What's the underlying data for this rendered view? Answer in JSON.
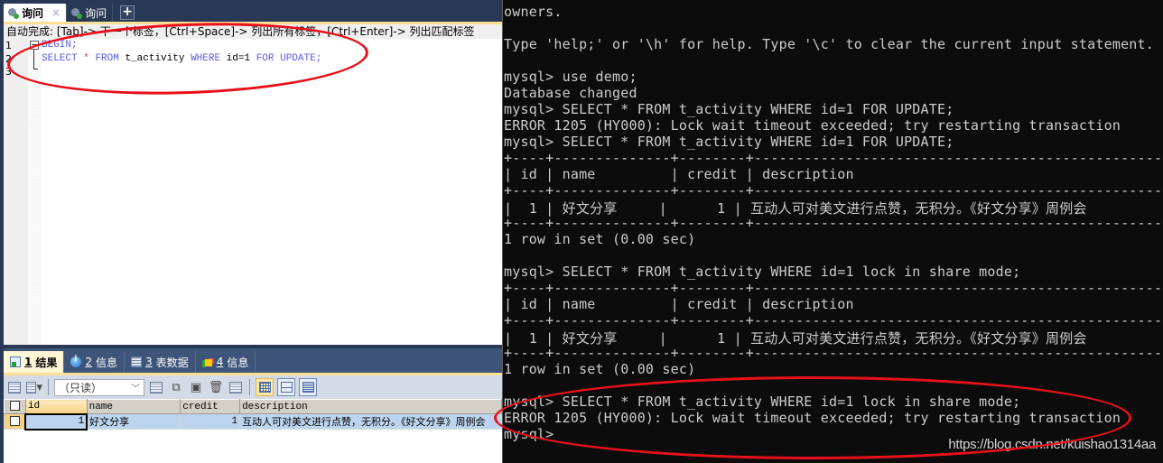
{
  "sql_client": {
    "query_tabs": [
      {
        "label": "询问",
        "active": true,
        "closable": true,
        "close_glyph": "×"
      },
      {
        "label": "询问",
        "active": false,
        "closable": false
      }
    ],
    "new_tab_glyph": "+",
    "autocomplete_hint": "自动完成: [Tab]-> 下一个标签，[Ctrl+Space]-> 列出所有标签，[Ctrl+Enter]-> 列出匹配标签",
    "editor": {
      "line_numbers": [
        "1",
        "2",
        "3"
      ],
      "lines": [
        {
          "tokens": [
            {
              "t": "BEGIN;",
              "c": "kw"
            }
          ]
        },
        {
          "tokens": [
            {
              "t": "SELECT",
              "c": "kw"
            },
            {
              "t": " ",
              "c": "id"
            },
            {
              "t": "*",
              "c": "op"
            },
            {
              "t": " ",
              "c": "id"
            },
            {
              "t": "FROM",
              "c": "kw"
            },
            {
              "t": " t_activity ",
              "c": "id"
            },
            {
              "t": "WHERE",
              "c": "kw"
            },
            {
              "t": " id=1 ",
              "c": "id"
            },
            {
              "t": "FOR UPDATE;",
              "c": "kw"
            }
          ]
        },
        {
          "tokens": []
        }
      ]
    },
    "result_tabs": [
      {
        "num": "1",
        "label": "结果",
        "icon": "result-grid-icon",
        "active": true
      },
      {
        "num": "2",
        "label": "信息",
        "icon": "info-icon",
        "active": false
      },
      {
        "num": "3",
        "label": "表数据",
        "icon": "table-data-icon",
        "active": false
      },
      {
        "num": "4",
        "label": "信息",
        "icon": "profiler-info-icon",
        "active": false
      }
    ],
    "toolbar": {
      "readonly_select": "（只读）",
      "chevron_glyph": "﹀",
      "icons": [
        "export-icon",
        "import-icon",
        "insert-row-icon",
        "duplicate-row-icon",
        "save-icon",
        "delete-icon",
        "cancel-changes-icon"
      ],
      "view_modes": [
        "grid-view",
        "form-view",
        "text-view"
      ],
      "active_view": "grid-view"
    },
    "result_grid": {
      "columns": [
        "id",
        "name",
        "credit",
        "description"
      ],
      "rows": [
        {
          "id": "1",
          "name": "好文分享",
          "credit": "1",
          "description": "互动人可对美文进行点赞，无积分。《好文分享》周例会"
        }
      ]
    }
  },
  "terminal": {
    "lines": [
      "owners.",
      "",
      "Type 'help;' or '\\h' for help. Type '\\c' to clear the current input statement.",
      "",
      "mysql> use demo;",
      "Database changed",
      "mysql> SELECT * FROM t_activity WHERE id=1 FOR UPDATE;",
      "ERROR 1205 (HY000): Lock wait timeout exceeded; try restarting transaction",
      "mysql> SELECT * FROM t_activity WHERE id=1 FOR UPDATE;",
      "+----+--------------+--------+------------------------------------------------------------",
      "| id | name         | credit | description",
      "+----+--------------+--------+------------------------------------------------------------",
      "|  1 | 好文分享     |      1 | 互动人可对美文进行点赞，无积分。《好文分享》周例会",
      "+----+--------------+--------+------------------------------------------------------------",
      "1 row in set (0.00 sec)",
      "",
      "mysql> SELECT * FROM t_activity WHERE id=1 lock in share mode;",
      "+----+--------------+--------+------------------------------------------------------------",
      "| id | name         | credit | description",
      "+----+--------------+--------+------------------------------------------------------------",
      "|  1 | 好文分享     |      1 | 互动人可对美文进行点赞，无积分。《好文分享》周例会",
      "+----+--------------+--------+------------------------------------------------------------",
      "1 row in set (0.00 sec)",
      "",
      "mysql> SELECT * FROM t_activity WHERE id=1 lock in share mode;",
      "ERROR 1205 (HY000): Lock wait timeout exceeded; try restarting transaction",
      "mysql>"
    ],
    "watermark": "https://blog.csdn.net/kuishao1314aa"
  },
  "annotations": {
    "highlight_color": "#e8101a"
  }
}
